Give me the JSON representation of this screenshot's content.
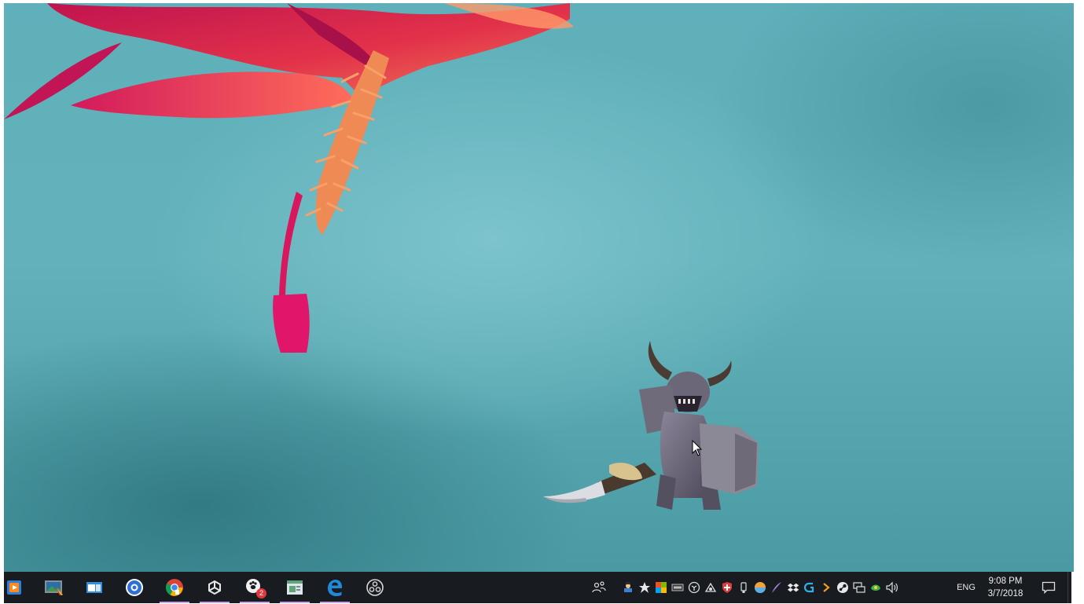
{
  "desktop": {
    "wallpaper": "teal background with pink-red flower (macro photo)",
    "overlay_character": "horned armored warrior with sword and shield"
  },
  "taskbar": {
    "pinned_apps": [
      {
        "name": "media-player",
        "icon": "play-icon",
        "active": false
      },
      {
        "name": "photos",
        "icon": "photo-icon",
        "active": false
      },
      {
        "name": "task-view",
        "icon": "window-icon",
        "active": false
      },
      {
        "name": "blue-circle-app",
        "icon": "circle-app-icon",
        "active": false
      },
      {
        "name": "chrome",
        "icon": "chrome-icon",
        "active": true
      },
      {
        "name": "unity",
        "icon": "unity-icon",
        "active": true
      },
      {
        "name": "paw-app",
        "icon": "paw-icon",
        "active": true,
        "badge": "2"
      },
      {
        "name": "notepad-app",
        "icon": "notepad-icon",
        "active": true
      },
      {
        "name": "edge",
        "icon": "edge-icon",
        "active": true
      },
      {
        "name": "obs",
        "icon": "obs-icon",
        "active": false
      }
    ],
    "tray": {
      "icons": [
        "people-icon",
        "tray-app-1-icon",
        "tray-app-2-icon",
        "tray-app-3-icon",
        "ssd-icon",
        "tray-app-5-icon",
        "tray-app-6-icon",
        "shield-icon",
        "usb-icon",
        "tray-app-9-icon",
        "feather-icon",
        "dropbox-icon",
        "logitech-icon",
        "tray-arrow-icon",
        "steam-icon",
        "network-icon",
        "tray-app-16-icon",
        "volume-icon"
      ],
      "language": "ENG",
      "time": "9:08 PM",
      "date": "3/7/2018"
    }
  },
  "colors": {
    "taskbar_bg": "#181b20",
    "active_indicator": "#c7a6e6",
    "desktop_teal": "#63b2bb"
  }
}
